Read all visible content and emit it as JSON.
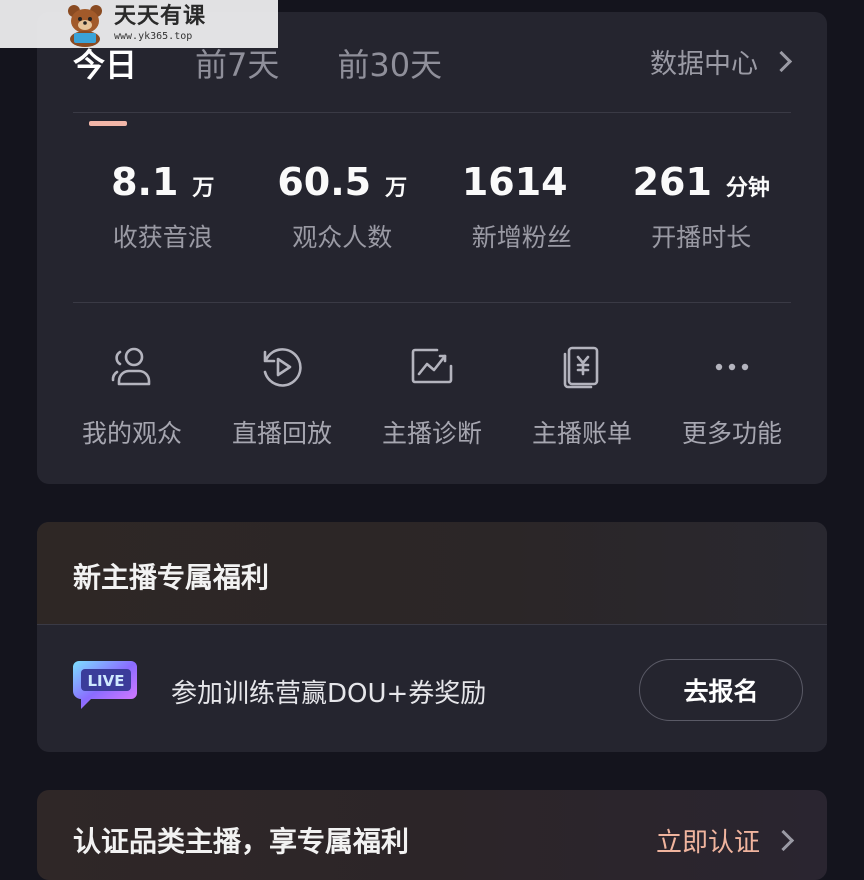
{
  "watermark": {
    "title": "天天有课",
    "url": "www.yk365.top"
  },
  "tabs": [
    {
      "label": "今日",
      "active": true
    },
    {
      "label": "前7天",
      "active": false
    },
    {
      "label": "前30天",
      "active": false
    }
  ],
  "data_center": {
    "label": "数据中心",
    "icon": "chevron-right-icon"
  },
  "stats": [
    {
      "value": "8.1",
      "unit": "万",
      "label": "收获音浪"
    },
    {
      "value": "60.5",
      "unit": "万",
      "label": "观众人数"
    },
    {
      "value": "1614",
      "unit": "",
      "label": "新增粉丝"
    },
    {
      "value": "261",
      "unit": "分钟",
      "label": "开播时长"
    }
  ],
  "tools": [
    {
      "label": "我的观众",
      "icon": "audience-icon"
    },
    {
      "label": "直播回放",
      "icon": "replay-icon"
    },
    {
      "label": "主播诊断",
      "icon": "diagnosis-icon"
    },
    {
      "label": "主播账单",
      "icon": "bill-icon"
    },
    {
      "label": "更多功能",
      "icon": "more-icon"
    }
  ],
  "welfare": {
    "title": "新主播专属福利",
    "item_text": "参加训练营赢DOU+券奖励",
    "button_label": "去报名",
    "badge_text": "LIVE"
  },
  "cert": {
    "title": "认证品类主播，享专属福利",
    "link_label": "立即认证"
  },
  "colors": {
    "background": "#14141d",
    "card": "#25252f",
    "tab_indicator": "#f2b6a8",
    "link_accent": "#f0b49e"
  }
}
